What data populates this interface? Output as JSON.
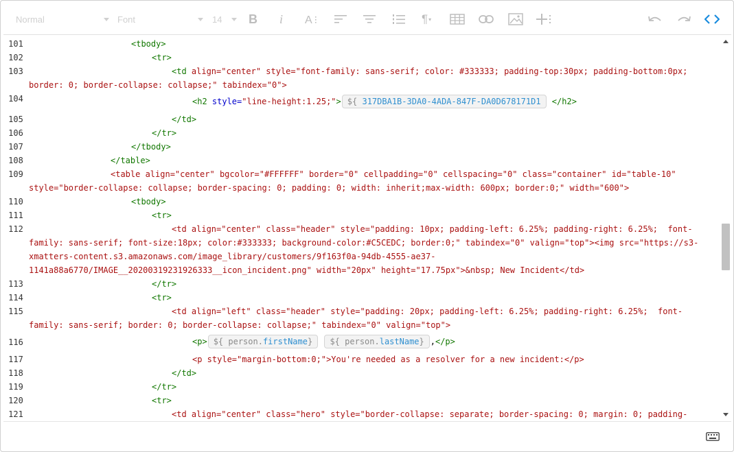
{
  "toolbar": {
    "paragraph_style": "Normal",
    "font_family": "Font",
    "font_size": "14",
    "icons": [
      "bold-icon",
      "italic-icon",
      "font-size-icon",
      "align-left-icon",
      "align-center-icon",
      "numbered-list-icon",
      "paragraph-icon",
      "table-icon",
      "link-icon",
      "image-icon",
      "insert-icon",
      "undo-icon",
      "redo-icon",
      "code-view-icon"
    ]
  },
  "editor": {
    "line_numbers": [
      "101",
      "102",
      "103",
      "",
      "104",
      "105",
      "106",
      "107",
      "108",
      "109",
      "",
      "110",
      "111",
      "112",
      "",
      "",
      "",
      "113",
      "114",
      "115",
      "",
      "116",
      "117",
      "118",
      "119",
      "120",
      "121"
    ],
    "chips": {
      "id_prefix": "${",
      "id_value": "317DBA1B-3DA0-4ADA-847F-DA0D678171D1",
      "first_prefix": "${",
      "first_obj": "person.",
      "first_prop": "firstName",
      "last_prefix": "${",
      "last_obj": "person.",
      "last_prop": "lastName",
      "close": "}"
    },
    "text": {
      "l101": "<tbody>",
      "l102": "<tr>",
      "l103a_tag": "<td",
      "l103a_rest": " align=\"center\" style=\"font-family: sans-serif; color: #333333; padding-top:30px; padding-bottom:0px;",
      "l103b": "border: 0; border-collapse: collapse;\" tabindex=\"0\">",
      "l104_tag": "<h2",
      "l104_attr": " style=",
      "l104_str": "\"line-height:1.25;\"",
      "l104_close": ">",
      "l104_end": "</h2>",
      "l105": "</td>",
      "l106": "</tr>",
      "l107": "</tbody>",
      "l108": "</table>",
      "l109a": "<table align=\"center\" bgcolor=\"#FFFFFF\" border=\"0\" cellpadding=\"0\" cellspacing=\"0\" class=\"container\" id=\"table-10\"",
      "l109b": "style=\"border-collapse: collapse; border-spacing: 0; padding: 0; width: inherit;max-width: 600px; border:0;\" width=\"600\">",
      "l110": "<tbody>",
      "l111": "<tr>",
      "l112a": "<td align=\"center\" class=\"header\" style=\"padding: 10px; padding-left: 6.25%; padding-right: 6.25%;  font-",
      "l112b": "family: sans-serif; font-size:18px; color:#333333; background-color:#C5CEDC; border:0;\" tabindex=\"0\" valign=\"top\"><img src=\"https://s3-",
      "l112c": "xmatters-content.s3.amazonaws.com/image_library/customers/9f163f0a-94db-4555-ae37-",
      "l112d": "1141a88a6770/IMAGE__20200319231926333__icon_incident.png\" width=\"20px\" height=\"17.75px\">&nbsp; New Incident</td>",
      "l113": "</tr>",
      "l114": "<tr>",
      "l115a": "<td align=\"left\" class=\"header\" style=\"padding: 20px; padding-left: 6.25%; padding-right: 6.25%;  font-",
      "l115b": "family: sans-serif; border: 0; border-collapse: collapse;\" tabindex=\"0\" valign=\"top\">",
      "l116_open": "<p>",
      "l116_comma": ",",
      "l116_close": "</p>",
      "l117": "<p style=\"margin-bottom:0;\">You're needed as a resolver for a new incident:</p>",
      "l118": "</td>",
      "l119": "</tr>",
      "l120": "<tr>",
      "l121": "<td align=\"center\" class=\"hero\" style=\"border-collapse: separate; border-spacing: 0; margin: 0; padding-"
    }
  },
  "colors": {
    "tag": "#117700",
    "attribute": "#0000cc",
    "string": "#aa1111",
    "active_icon": "#1a8cde",
    "chip_variable": "#2f8fd0"
  }
}
